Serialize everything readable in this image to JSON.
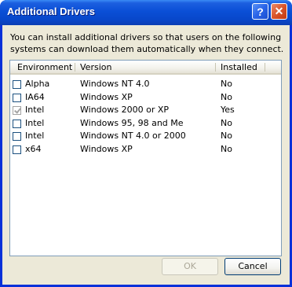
{
  "window": {
    "title": "Additional Drivers",
    "help_glyph": "?",
    "close_glyph": "✕"
  },
  "description": "You can install additional drivers so that users on the following systems can download them automatically when they connect.",
  "table": {
    "columns": [
      "Environment",
      "Version",
      "Installed"
    ],
    "rows": [
      {
        "environment": "Alpha",
        "version": "Windows NT 4.0",
        "installed": "No",
        "checked": false
      },
      {
        "environment": "IA64",
        "version": "Windows XP",
        "installed": "No",
        "checked": false
      },
      {
        "environment": "Intel",
        "version": "Windows 2000 or XP",
        "installed": "Yes",
        "checked": true
      },
      {
        "environment": "Intel",
        "version": "Windows 95, 98 and Me",
        "installed": "No",
        "checked": false
      },
      {
        "environment": "Intel",
        "version": "Windows NT 4.0 or 2000",
        "installed": "No",
        "checked": false
      },
      {
        "environment": "x64",
        "version": "Windows XP",
        "installed": "No",
        "checked": false
      }
    ]
  },
  "buttons": {
    "ok_label": "OK",
    "ok_enabled": false,
    "cancel_label": "Cancel"
  }
}
